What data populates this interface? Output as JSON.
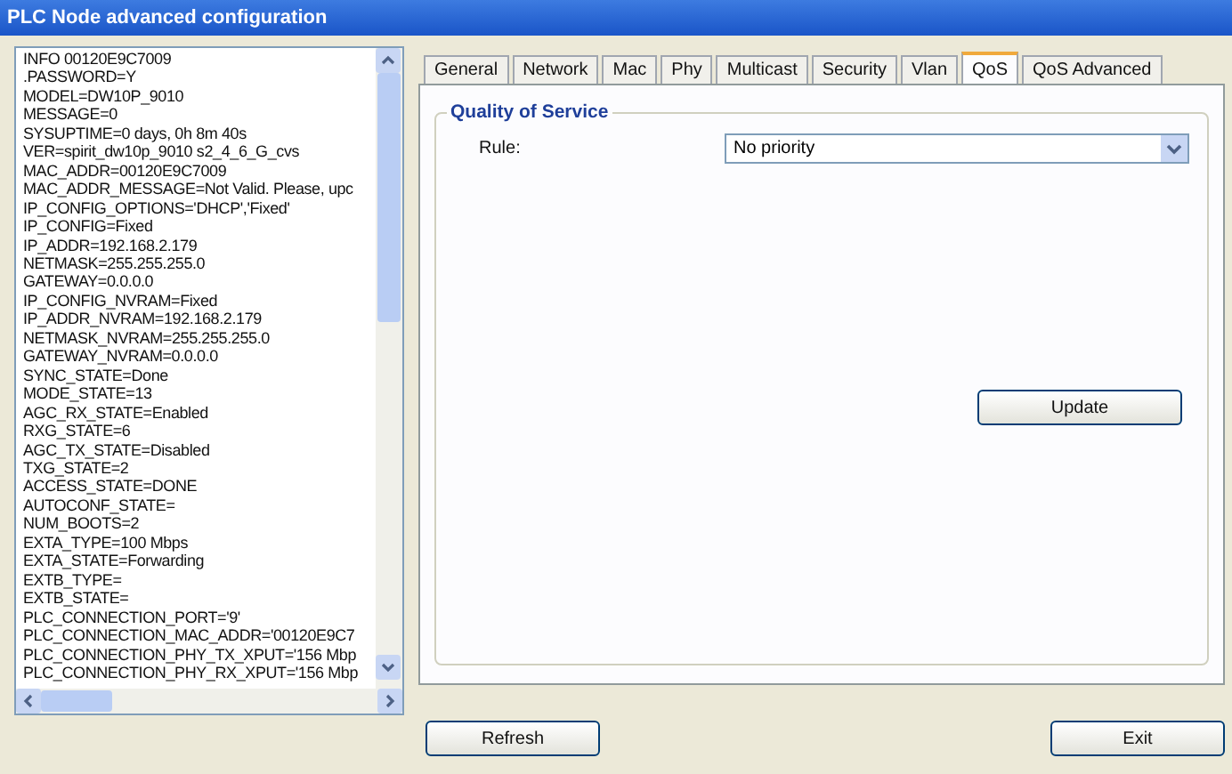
{
  "window": {
    "title": "PLC Node advanced configuration"
  },
  "info_lines": [
    "INFO 00120E9C7009",
    ".PASSWORD=Y",
    "MODEL=DW10P_9010",
    "MESSAGE=0",
    "SYSUPTIME=0 days, 0h 8m 40s",
    "VER=spirit_dw10p_9010 s2_4_6_G_cvs",
    "MAC_ADDR=00120E9C7009",
    "MAC_ADDR_MESSAGE=Not Valid. Please, upc",
    "IP_CONFIG_OPTIONS='DHCP','Fixed'",
    "IP_CONFIG=Fixed",
    "IP_ADDR=192.168.2.179",
    "NETMASK=255.255.255.0",
    "GATEWAY=0.0.0.0",
    "IP_CONFIG_NVRAM=Fixed",
    "IP_ADDR_NVRAM=192.168.2.179",
    "NETMASK_NVRAM=255.255.255.0",
    "GATEWAY_NVRAM=0.0.0.0",
    "SYNC_STATE=Done",
    "MODE_STATE=13",
    "AGC_RX_STATE=Enabled",
    "RXG_STATE=6",
    "AGC_TX_STATE=Disabled",
    "TXG_STATE=2",
    "ACCESS_STATE=DONE",
    "AUTOCONF_STATE=",
    "NUM_BOOTS=2",
    "EXTA_TYPE=100 Mbps",
    "EXTA_STATE=Forwarding",
    "EXTB_TYPE=",
    "EXTB_STATE=",
    "PLC_CONNECTION_PORT='9'",
    "PLC_CONNECTION_MAC_ADDR='00120E9C7",
    "PLC_CONNECTION_PHY_TX_XPUT='156 Mbp",
    "PLC_CONNECTION_PHY_RX_XPUT='156 Mbp"
  ],
  "tabs": [
    {
      "label": "General",
      "selected": false
    },
    {
      "label": "Network",
      "selected": false
    },
    {
      "label": "Mac",
      "selected": false
    },
    {
      "label": "Phy",
      "selected": false
    },
    {
      "label": "Multicast",
      "selected": false
    },
    {
      "label": "Security",
      "selected": false
    },
    {
      "label": "Vlan",
      "selected": false
    },
    {
      "label": "QoS",
      "selected": true
    },
    {
      "label": "QoS Advanced",
      "selected": false
    }
  ],
  "group": {
    "title": "Quality of Service",
    "rule_label": "Rule:",
    "rule_value": "No priority",
    "update_button": "Update"
  },
  "buttons": {
    "refresh": "Refresh",
    "exit": "Exit"
  }
}
